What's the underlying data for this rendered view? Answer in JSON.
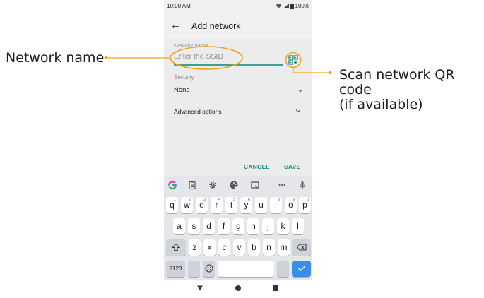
{
  "callouts": {
    "network_name": "Network name",
    "scan_qr_line1": "Scan network QR code",
    "scan_qr_line2": "(if available)"
  },
  "status_bar": {
    "time": "10:00 AM",
    "battery": "100%"
  },
  "app_bar": {
    "title": "Add network",
    "back_icon": "arrow-back-icon"
  },
  "form": {
    "network_name_label": "Network name",
    "ssid_placeholder": "Enter the SSID",
    "ssid_value": "",
    "security_label": "Security",
    "security_value": "None",
    "advanced_options": "Advanced options",
    "cancel": "CANCEL",
    "save": "SAVE"
  },
  "colors": {
    "accent": "#1f8d80",
    "callout_orange": "#f5a21c",
    "enter_key": "#3b8ee8"
  },
  "keyboard": {
    "suggestion_icons": [
      "google-icon",
      "clipboard-icon",
      "settings-icon",
      "palette-icon",
      "screenshot-icon",
      "more-icon",
      "mic-icon"
    ],
    "row1": [
      "q",
      "w",
      "e",
      "r",
      "t",
      "y",
      "u",
      "i",
      "o",
      "p"
    ],
    "row1_hints": [
      "1",
      "2",
      "3",
      "4",
      "5",
      "6",
      "7",
      "8",
      "9",
      "0"
    ],
    "row2": [
      "a",
      "s",
      "d",
      "f",
      "g",
      "h",
      "j",
      "k",
      "l"
    ],
    "row3": [
      "z",
      "x",
      "c",
      "v",
      "b",
      "n",
      "m"
    ],
    "symbols_key": "?123",
    "comma_key": ",",
    "period_key": "."
  }
}
